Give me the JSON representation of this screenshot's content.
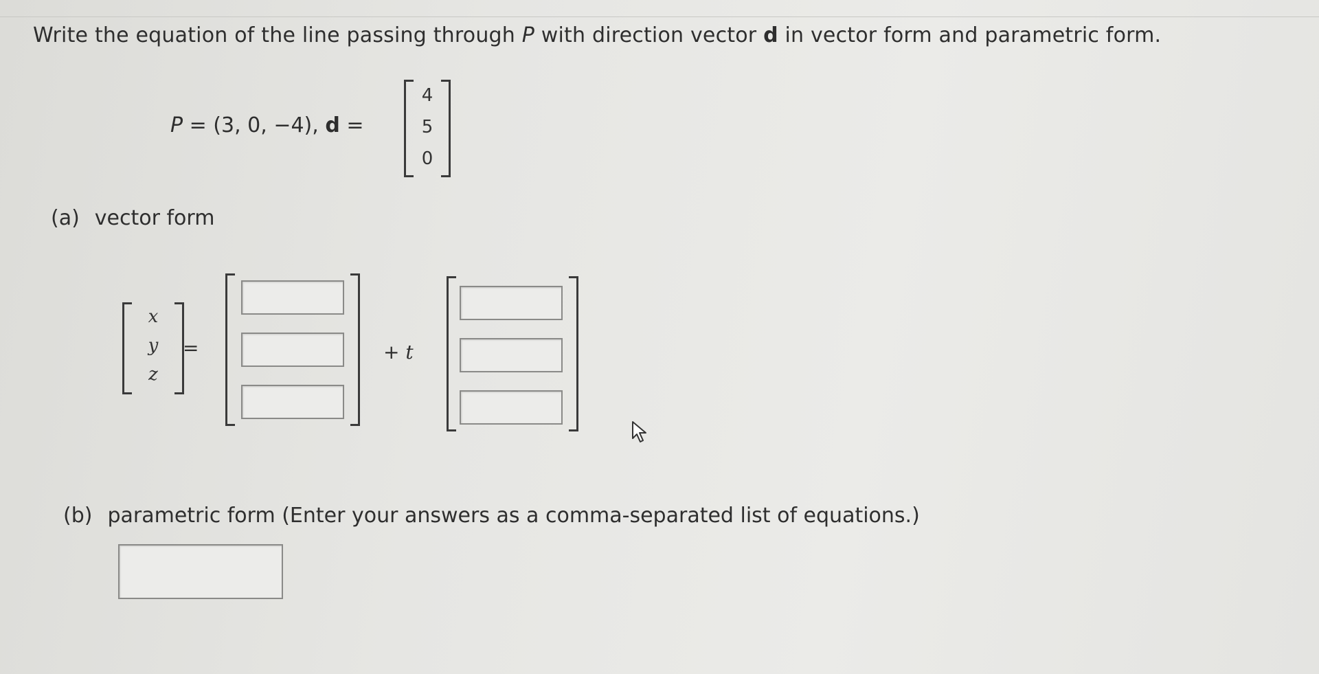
{
  "question": {
    "part1": "Write the equation of the line passing through ",
    "P": "P",
    "part2": " with direction vector ",
    "d": "d",
    "part3": " in vector form and parametric form."
  },
  "given": {
    "P_label": "P",
    "P_value": " = (3, 0, −4), ",
    "d_label": "d",
    "d_eq": " =",
    "d_vector": [
      "4",
      "5",
      "0"
    ]
  },
  "part_a": {
    "letter": "(a)",
    "label": "vector form",
    "lhs": [
      "x",
      "y",
      "z"
    ],
    "equals": "=",
    "plus": "+ ",
    "param": "t",
    "point_inputs": [
      "",
      "",
      ""
    ],
    "direction_inputs": [
      "",
      "",
      ""
    ]
  },
  "part_b": {
    "letter": "(b)",
    "label": "parametric form (Enter your answers as a comma-separated list of equations.)",
    "input": ""
  },
  "icons": {
    "cursor": "mouse-pointer-icon"
  }
}
